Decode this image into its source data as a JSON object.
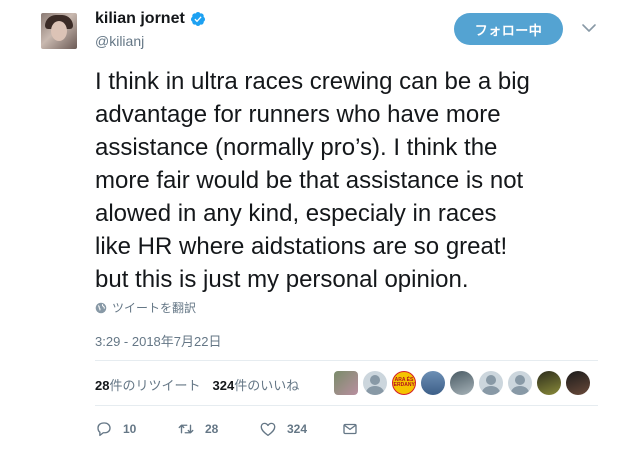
{
  "user": {
    "display_name": "kilian jornet",
    "handle": "@kilianj",
    "verified": true
  },
  "follow_button": {
    "label": "フォロー中"
  },
  "tweet": {
    "lines": [
      "I think in ultra races crewing can be a big",
      "advantage for runners who have more",
      "assistance (normally pro’s). I think the",
      "more fair would be that assistance is not",
      "alowed in any kind, especialy in races",
      "like HR where aidstations are so great!",
      "but this is just my personal opinion."
    ],
    "translate_label": "ツイートを翻訳",
    "timestamp": "3:29 - 2018年7月22日"
  },
  "stats": {
    "retweets_count": "28",
    "retweets_label": "件のリツイート",
    "likes_count": "324",
    "likes_label": "件のいいね",
    "liker_badge_text": "ARA ÉS CERDANYA"
  },
  "actions": {
    "reply_count": "10",
    "retweet_count": "28",
    "like_count": "324"
  },
  "colors": {
    "accent": "#54a3d2",
    "verified": "#1da1f2",
    "muted": "#657786",
    "text": "#14171a"
  },
  "icons": [
    "verified-badge-icon",
    "chevron-down-icon",
    "globe-icon",
    "reply-icon",
    "retweet-icon",
    "heart-icon",
    "direct-message-icon"
  ]
}
